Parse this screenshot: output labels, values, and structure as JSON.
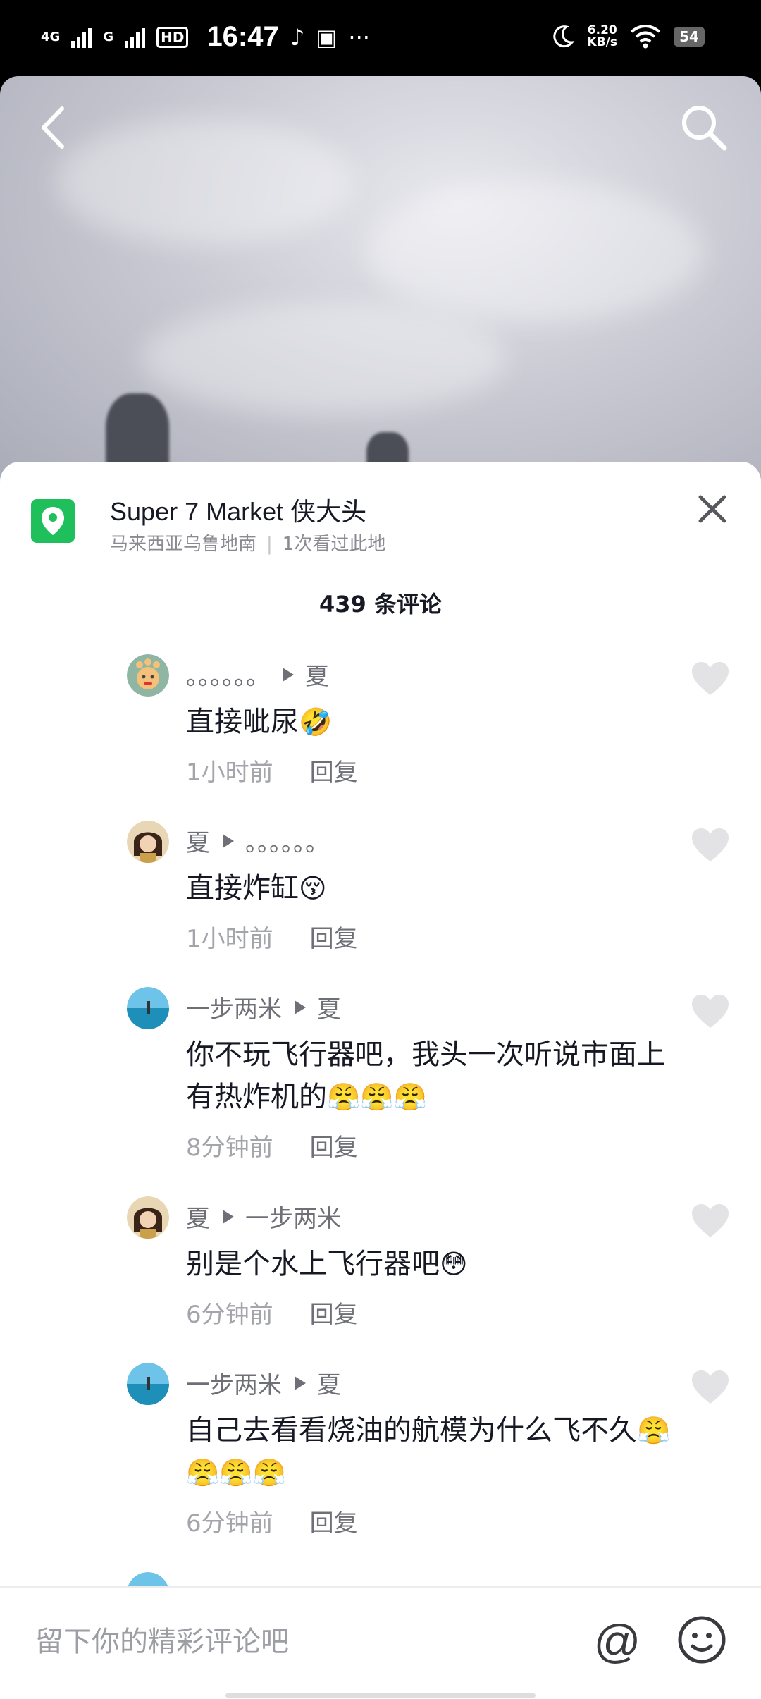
{
  "status_bar": {
    "signal1": "4G",
    "signal2": "G",
    "hd": "HD",
    "hd_sub": "1",
    "time": "16:47",
    "more": "···",
    "speed_value": "6.20",
    "speed_unit": "KB/s",
    "battery": "54"
  },
  "location": {
    "title": "Super 7 Market 侠大头",
    "region": "马来西亚乌鲁地南",
    "views": "1次看过此地"
  },
  "comment_count": "439 条评论",
  "comments": [
    {
      "from": "。。。。。。",
      "to": "夏",
      "text": "直接呲尿",
      "emoji": "🤣",
      "time": "1小时前",
      "reply": "回复"
    },
    {
      "from": "夏",
      "to": "。。。。。。",
      "text": "直接炸缸",
      "emoji": "😚",
      "time": "1小时前",
      "reply": "回复"
    },
    {
      "from": "一步两米",
      "to": "夏",
      "text": "你不玩飞行器吧，我头一次听说市面上有热炸机的",
      "emoji": "😤😤😤",
      "time": "8分钟前",
      "reply": "回复"
    },
    {
      "from": "夏",
      "to": "一步两米",
      "text": "别是个水上飞行器吧",
      "emoji": "😳",
      "time": "6分钟前",
      "reply": "回复"
    },
    {
      "from": "一步两米",
      "to": "夏",
      "text": "自己去看看烧油的航模为什么飞不久",
      "emoji": "😤😤😤😤",
      "time": "6分钟前",
      "reply": "回复"
    }
  ],
  "input": {
    "placeholder": "留下你的精彩评论吧",
    "at": "@"
  }
}
